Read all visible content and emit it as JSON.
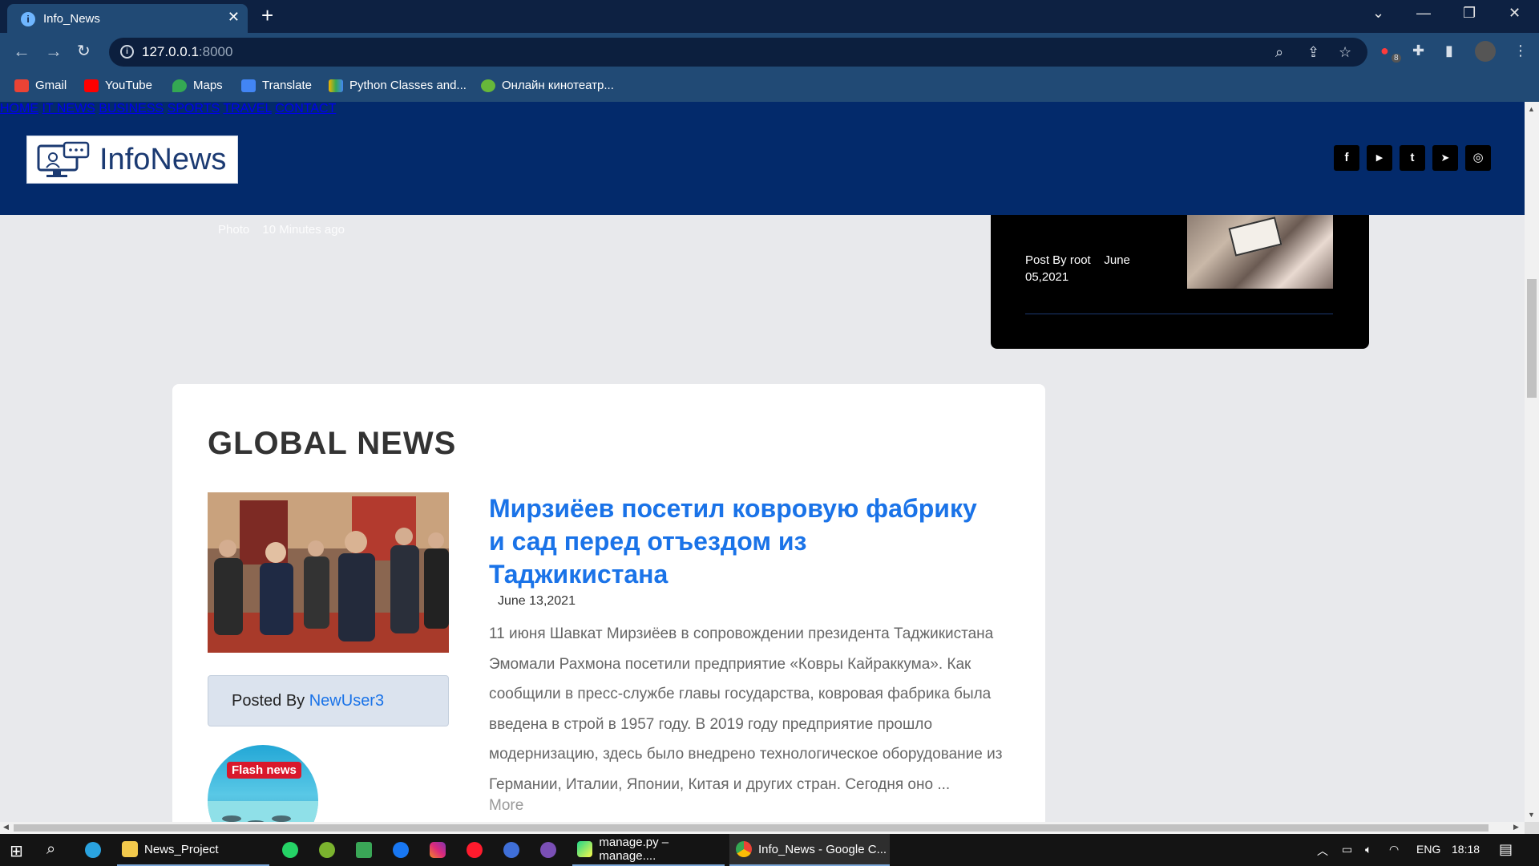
{
  "browser": {
    "tab_title": "Info_News",
    "tab_favicon": "i",
    "new_tab": "+",
    "url_host": "127.0.0.1",
    "url_port": ":8000",
    "bookmarks": [
      {
        "label": "Gmail",
        "icon": "gmail-icon",
        "color": "#ea4335"
      },
      {
        "label": "YouTube",
        "icon": "youtube-icon",
        "color": "#ff0000"
      },
      {
        "label": "Maps",
        "icon": "maps-icon",
        "color": "#34a853"
      },
      {
        "label": "Translate",
        "icon": "translate-icon",
        "color": "#4285f4"
      },
      {
        "label": "Python Classes and...",
        "icon": "python-classes-icon",
        "color": "#f4b400"
      },
      {
        "label": "Онлайн кинотеатр...",
        "icon": "cinema-icon",
        "color": "#67b73a"
      }
    ],
    "extension_badge": "8"
  },
  "site": {
    "logo_text": "InfoNews",
    "nav": [
      "HOME",
      "IT NEWS",
      "BUSINESS",
      "SPORTS",
      "TRAVEL",
      "CONTACT"
    ],
    "social": [
      {
        "icon": "facebook-icon",
        "glyph": "f"
      },
      {
        "icon": "youtube-icon",
        "glyph": "▶"
      },
      {
        "icon": "twitter-icon",
        "glyph": "t"
      },
      {
        "icon": "telegram-icon",
        "glyph": "➤"
      },
      {
        "icon": "instagram-icon",
        "glyph": "◎"
      }
    ],
    "accent_color": "#032a6b"
  },
  "behind_header": {
    "photo_label": "Photo",
    "photo_time": "10 Minutes ago"
  },
  "trending": {
    "post_by": "Post By root",
    "date": "June 05,2021"
  },
  "global_news": {
    "section_title": "GLOBAL NEWS",
    "headline": "Мирзиёев посетил ковровую фабрику и сад перед отъездом из Таджикистана",
    "date": "June 13,2021",
    "body": "11 июня Шавкат Мирзиёев в сопровождении президента Таджикистана Эмомали Рахмона посетили предприятие «Ковры Кайраккума». Как сообщили в пресс-службе главы государства, ковровая фабрика была введена в строй в 1957 году. В 2019 году предприятие прошло модернизацию, здесь было внедрено технологическое оборудование из Германии, Италии, Японии, Китая и других стран. Сегодня оно ...",
    "more": "More",
    "posted_by_label": "Posted By",
    "posted_by_user": "NewUser3",
    "flash_badge": "Flash news"
  },
  "taskbar": {
    "items": [
      {
        "label": "News_Project",
        "icon": "folder-icon"
      },
      {
        "label": "manage.py – manage....",
        "icon": "pycharm-icon"
      },
      {
        "label": "Info_News - Google C...",
        "icon": "chrome-icon"
      }
    ],
    "language": "ENG",
    "time": "18:18"
  }
}
